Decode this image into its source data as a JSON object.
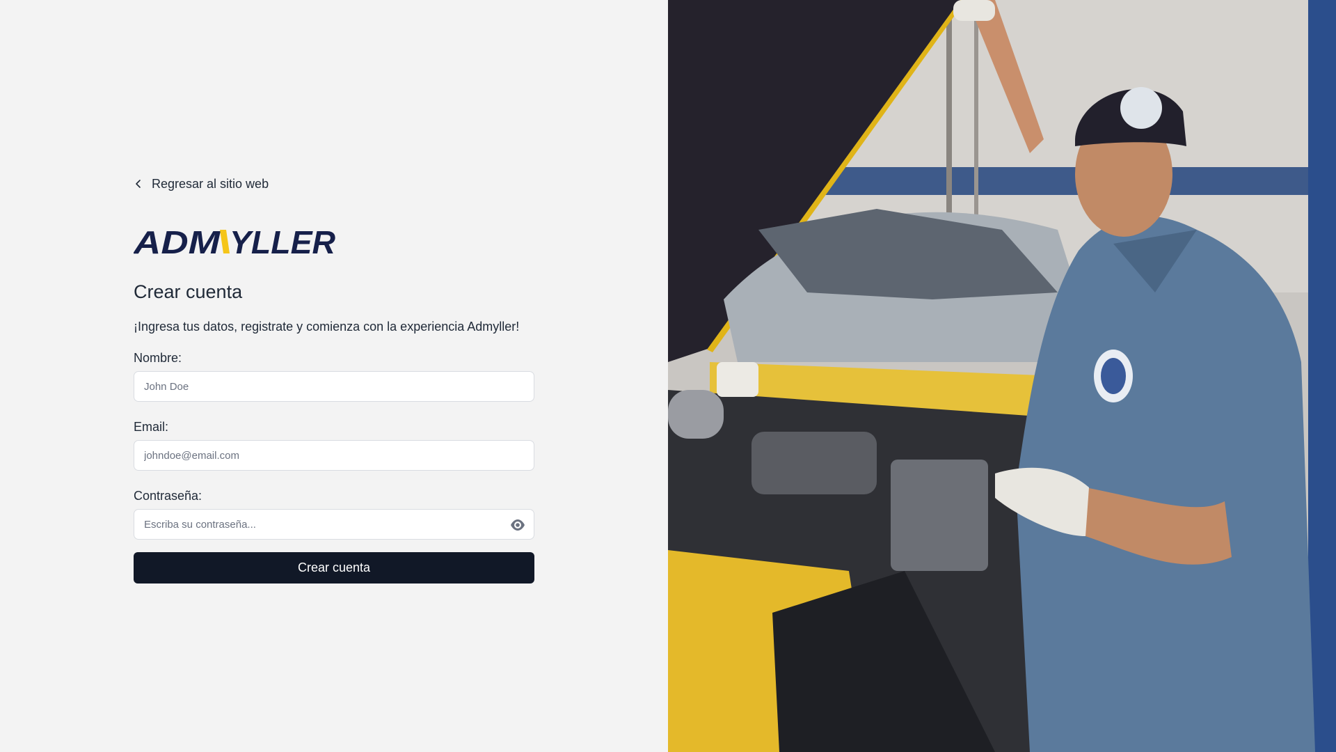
{
  "back_link": {
    "label": "Regresar al sitio web",
    "icon": "chevron-left-icon"
  },
  "brand": {
    "name": "ADMYLLER",
    "color_primary": "#16204a",
    "color_accent": "#f5c518"
  },
  "form": {
    "title": "Crear cuenta",
    "subtitle": "¡Ingresa tus datos, registrate y comienza con la experiencia Admyller!",
    "name_label": "Nombre:",
    "name_placeholder": "John Doe",
    "email_label": "Email:",
    "email_placeholder": "johndoe@email.com",
    "password_label": "Contraseña:",
    "password_placeholder": "Escriba su contraseña...",
    "password_toggle_icon": "eye-icon",
    "submit_label": "Crear cuenta"
  },
  "colors": {
    "page_bg": "#f3f3f3",
    "button_bg": "#111827",
    "text": "#1f2937"
  },
  "hero_image": {
    "subject": "mechanic-under-car-hood"
  }
}
